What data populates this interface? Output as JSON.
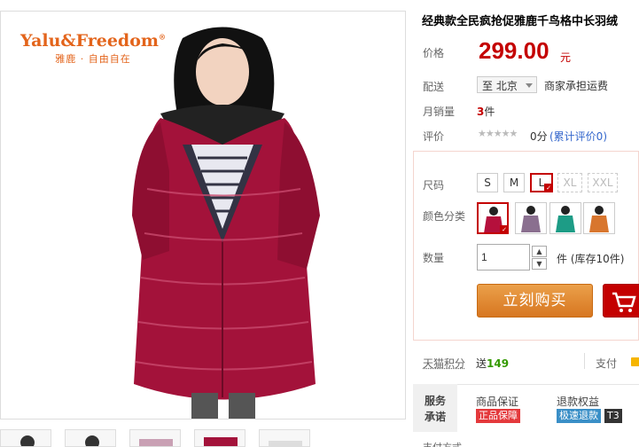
{
  "brand": {
    "name_en": "Yalu&Freedom",
    "trademark": "®",
    "tagline_cn": "雅鹿 · 自由自在"
  },
  "product": {
    "title": "经典款全民疯抢促雅鹿千鸟格中长羽绒",
    "price_label": "价格",
    "price": "299.00",
    "price_unit": "元",
    "shipping_label": "配送",
    "shipping_dest": "至 北京",
    "shipping_note": "商家承担运费",
    "sales_label": "月销量",
    "sales_count": "3",
    "sales_unit": "件",
    "rating_label": "评价",
    "rating_stars": "★★★★★",
    "rating_score": "0分",
    "rating_link": "(累计评价0)"
  },
  "options": {
    "size_label": "尺码",
    "sizes": [
      {
        "label": "S",
        "state": "normal"
      },
      {
        "label": "M",
        "state": "normal"
      },
      {
        "label": "L",
        "state": "selected"
      },
      {
        "label": "XL",
        "state": "disabled"
      },
      {
        "label": "XXL",
        "state": "disabled"
      }
    ],
    "color_label": "颜色分类",
    "colors": [
      {
        "name": "红色",
        "hex": "#b5103c",
        "selected": true
      },
      {
        "name": "紫色",
        "hex": "#8a6f8f",
        "selected": false
      },
      {
        "name": "绿色",
        "hex": "#1d9c86",
        "selected": false
      },
      {
        "name": "橙色",
        "hex": "#d8762e",
        "selected": false
      }
    ],
    "qty_label": "数量",
    "qty_value": "1",
    "stepper_up": "▲",
    "stepper_down": "▼",
    "stock_text": "件  (库存10件)"
  },
  "actions": {
    "buy_now": "立刻购买",
    "add_cart_icon": "cart-icon"
  },
  "points": {
    "label": "天猫积分",
    "prefix": "送",
    "value": "149"
  },
  "pay": {
    "label": "支付"
  },
  "service": {
    "head_line1": "服务",
    "head_line2": "承诺",
    "guarantee_title": "商品保证",
    "guarantee_badge": "正品保障",
    "refund_title": "退款权益",
    "refund_badge": "极速退款",
    "refund_tag": "T3"
  },
  "bottom": {
    "label": "支付方式"
  },
  "colors": {
    "price": "#c40000",
    "accent": "#c40000",
    "brand_orange": "#e3641b",
    "buy_button": "#e08a34"
  }
}
